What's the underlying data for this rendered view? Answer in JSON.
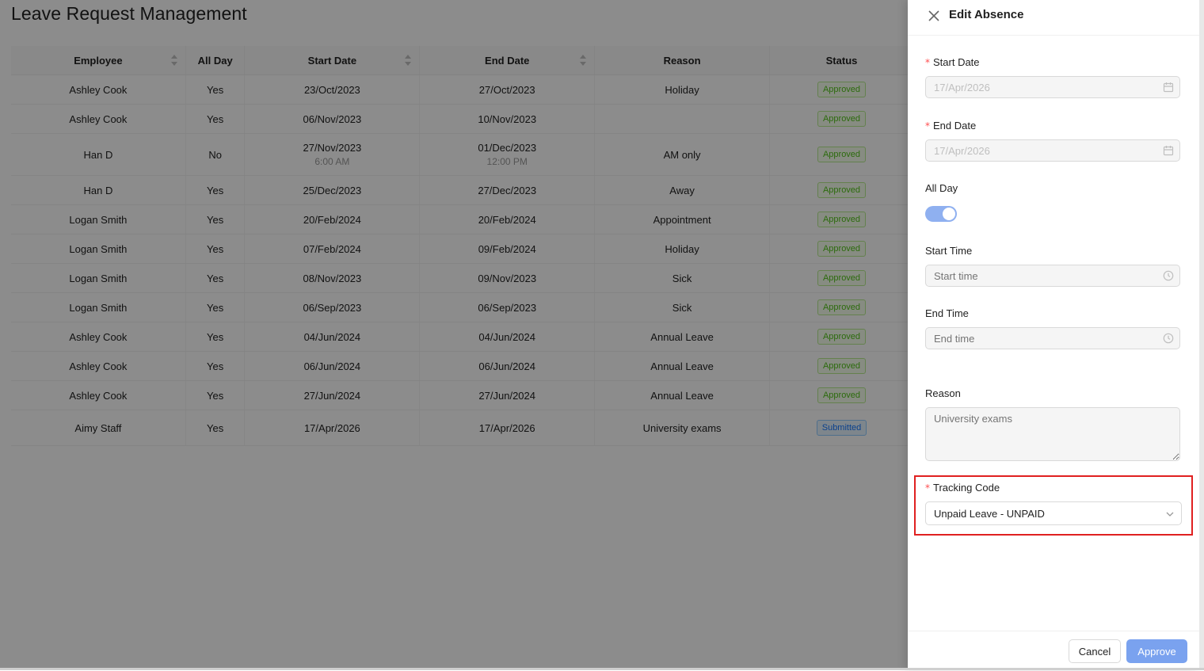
{
  "page": {
    "title": "Leave Request Management",
    "columns": [
      "Employee",
      "All Day",
      "Start Date",
      "End Date",
      "Reason",
      "Status"
    ],
    "rows": [
      {
        "employee": "Ashley Cook",
        "all_day": "Yes",
        "start": "23/Oct/2023",
        "start_time": "",
        "end": "27/Oct/2023",
        "end_time": "",
        "reason": "Holiday",
        "status": "Approved"
      },
      {
        "employee": "Ashley Cook",
        "all_day": "Yes",
        "start": "06/Nov/2023",
        "start_time": "",
        "end": "10/Nov/2023",
        "end_time": "",
        "reason": "",
        "status": "Approved"
      },
      {
        "employee": "Han D",
        "all_day": "No",
        "start": "27/Nov/2023",
        "start_time": "6:00 AM",
        "end": "01/Dec/2023",
        "end_time": "12:00 PM",
        "reason": "AM only",
        "status": "Approved"
      },
      {
        "employee": "Han D",
        "all_day": "Yes",
        "start": "25/Dec/2023",
        "start_time": "",
        "end": "27/Dec/2023",
        "end_time": "",
        "reason": "Away",
        "status": "Approved"
      },
      {
        "employee": "Logan Smith",
        "all_day": "Yes",
        "start": "20/Feb/2024",
        "start_time": "",
        "end": "20/Feb/2024",
        "end_time": "",
        "reason": "Appointment",
        "status": "Approved"
      },
      {
        "employee": "Logan Smith",
        "all_day": "Yes",
        "start": "07/Feb/2024",
        "start_time": "",
        "end": "09/Feb/2024",
        "end_time": "",
        "reason": "Holiday",
        "status": "Approved"
      },
      {
        "employee": "Logan Smith",
        "all_day": "Yes",
        "start": "08/Nov/2023",
        "start_time": "",
        "end": "09/Nov/2023",
        "end_time": "",
        "reason": "Sick",
        "status": "Approved"
      },
      {
        "employee": "Logan Smith",
        "all_day": "Yes",
        "start": "06/Sep/2023",
        "start_time": "",
        "end": "06/Sep/2023",
        "end_time": "",
        "reason": "Sick",
        "status": "Approved"
      },
      {
        "employee": "Ashley Cook",
        "all_day": "Yes",
        "start": "04/Jun/2024",
        "start_time": "",
        "end": "04/Jun/2024",
        "end_time": "",
        "reason": "Annual Leave",
        "status": "Approved"
      },
      {
        "employee": "Ashley Cook",
        "all_day": "Yes",
        "start": "06/Jun/2024",
        "start_time": "",
        "end": "06/Jun/2024",
        "end_time": "",
        "reason": "Annual Leave",
        "status": "Approved"
      },
      {
        "employee": "Ashley Cook",
        "all_day": "Yes",
        "start": "27/Jun/2024",
        "start_time": "",
        "end": "27/Jun/2024",
        "end_time": "",
        "reason": "Annual Leave",
        "status": "Approved"
      },
      {
        "employee": "Aimy Staff",
        "all_day": "Yes",
        "start": "17/Apr/2026",
        "start_time": "",
        "end": "17/Apr/2026",
        "end_time": "",
        "reason": "University exams",
        "status": "Submitted"
      }
    ]
  },
  "drawer": {
    "title": "Edit Absence",
    "start_date": {
      "label": "Start Date",
      "value": "17/Apr/2026",
      "required": true
    },
    "end_date": {
      "label": "End Date",
      "value": "17/Apr/2026",
      "required": true
    },
    "all_day": {
      "label": "All Day",
      "on": true
    },
    "start_time": {
      "label": "Start Time",
      "placeholder": "Start time"
    },
    "end_time": {
      "label": "End Time",
      "placeholder": "End time"
    },
    "reason": {
      "label": "Reason",
      "placeholder": "University exams"
    },
    "tracking_code": {
      "label": "Tracking Code",
      "value": "Unpaid Leave - UNPAID",
      "required": true
    },
    "cancel_label": "Cancel",
    "approve_label": "Approve"
  },
  "colors": {
    "primary": "#7aa2ef",
    "approved": "#52c41a",
    "submitted": "#1677ff",
    "required": "#ff4d4f",
    "highlight": "#e02020"
  },
  "icons": [
    "close-icon",
    "calendar-icon",
    "clock-icon",
    "chevron-down-icon",
    "sort-icon"
  ]
}
